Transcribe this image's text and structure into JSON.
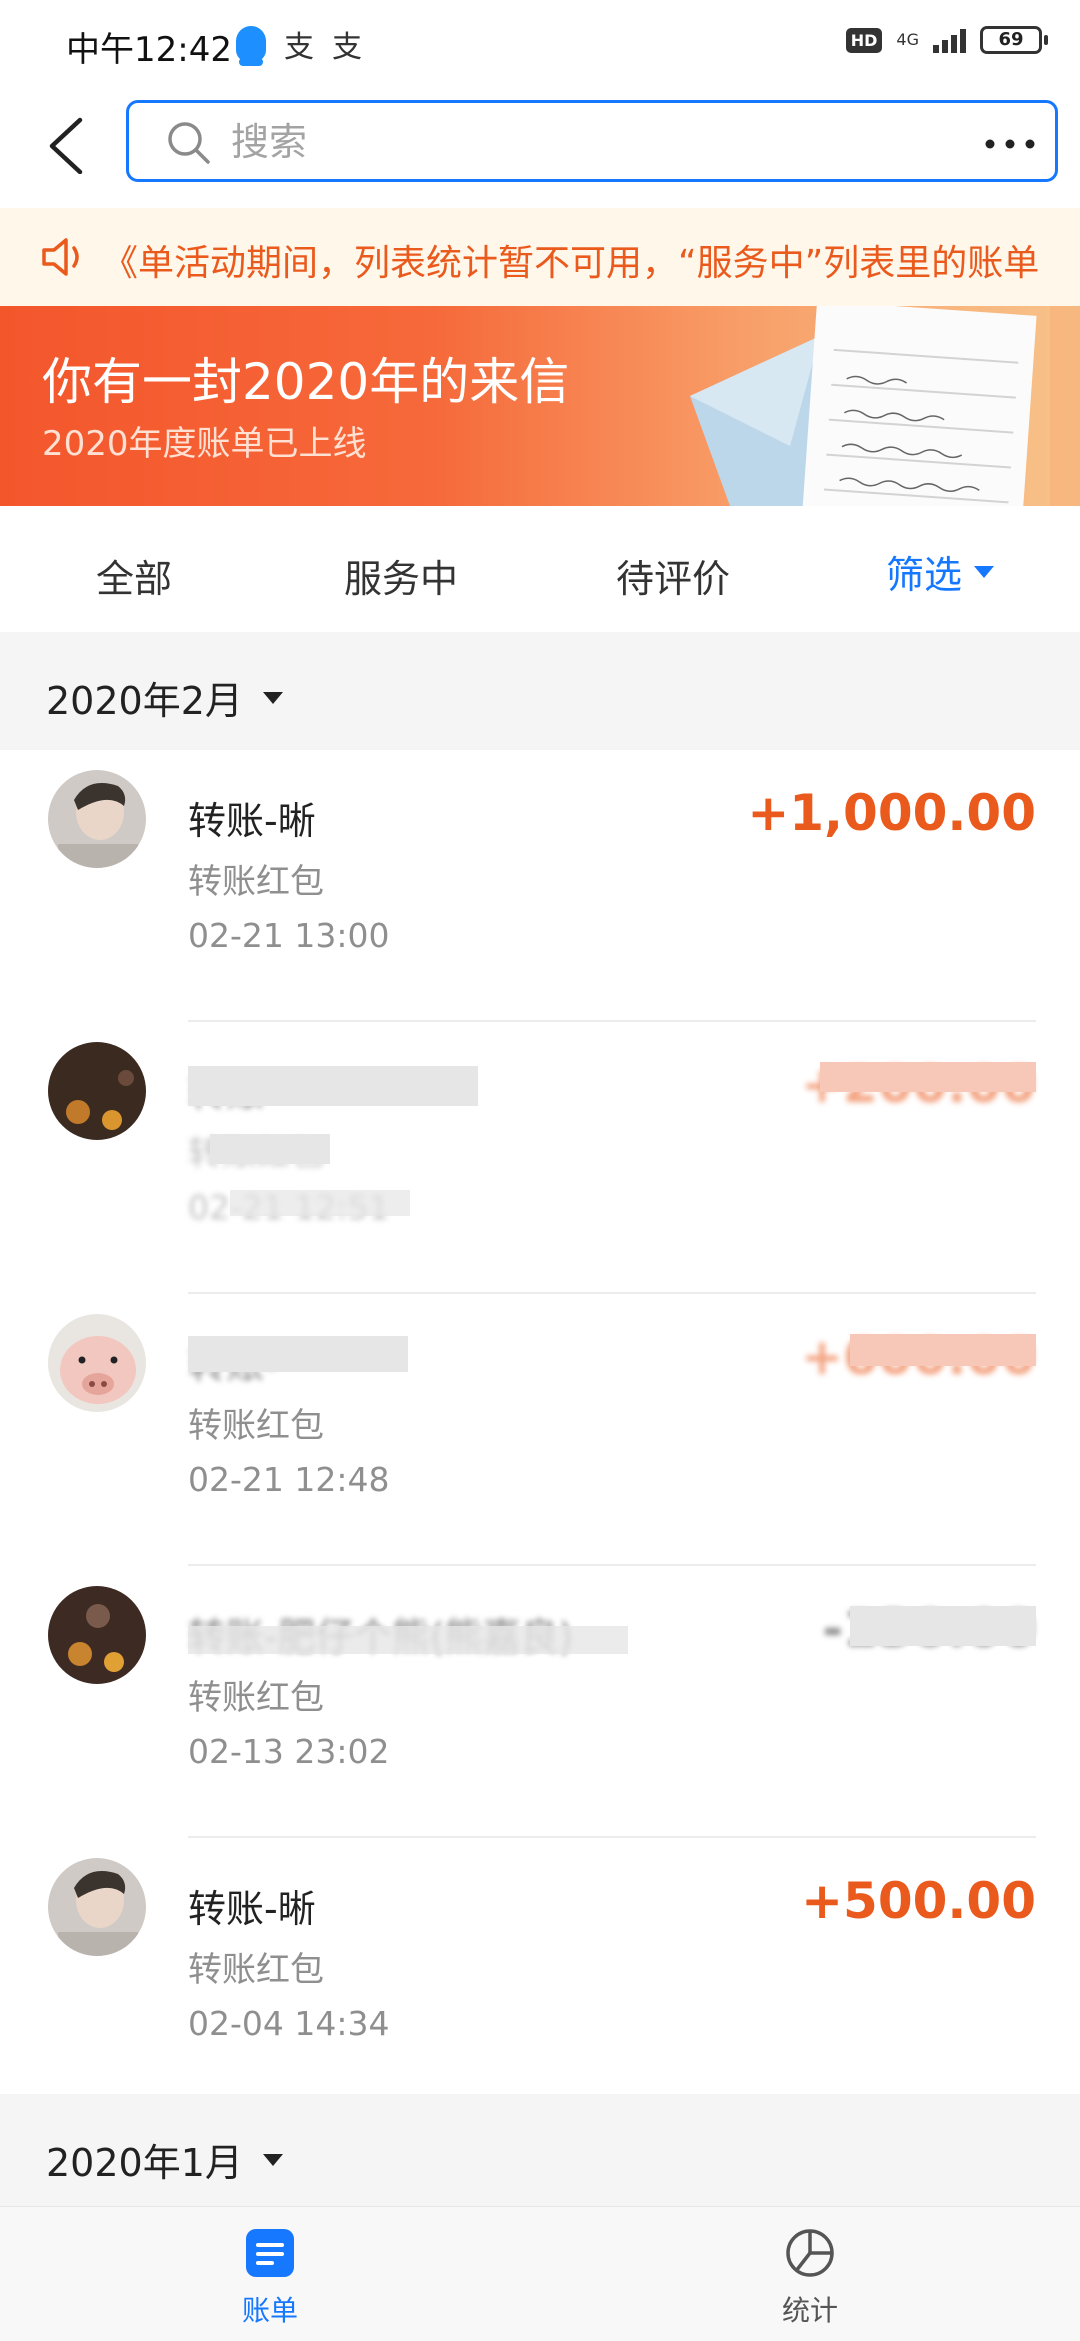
{
  "status_bar": {
    "time": "中午12:42",
    "zhi1": "支",
    "zhi2": "支",
    "hd": "HD",
    "network": "4G",
    "battery": "69"
  },
  "search": {
    "placeholder": "搜索"
  },
  "notice": {
    "text": "《单活动期间，列表统计暂不可用，“服务中”列表里的账单"
  },
  "banner": {
    "title": "你有一封2020年的来信",
    "subtitle": "2020年度账单已上线"
  },
  "tabs": {
    "all": "全部",
    "in_service": "服务中",
    "to_review": "待评价",
    "filter": "筛选"
  },
  "months": {
    "feb": "2020年2月",
    "jan": "2020年1月"
  },
  "transactions": [
    {
      "title": "转账-晰",
      "subtitle": "转账红包",
      "date": "02-21  13:00",
      "amount": "+1,000.00"
    },
    {
      "title": "转账-",
      "subtitle": "转账红包",
      "date": "02-21  12:51",
      "amount": "+200.00"
    },
    {
      "title": "转账-",
      "subtitle": "转账红包",
      "date": "02-21  12:48",
      "amount": "+600.00"
    },
    {
      "title": "转账-肥仔个熊(熊嘉良)",
      "subtitle": "转账红包",
      "date": "02-13  23:02",
      "amount": "-130.00"
    },
    {
      "title": "转账-晰",
      "subtitle": "转账红包",
      "date": "02-04  14:34",
      "amount": "+500.00"
    }
  ],
  "bottom_nav": {
    "bills": "账单",
    "stats": "统计"
  },
  "colors": {
    "accent": "#1677ff",
    "amount": "#ea5a1d",
    "notice_bg": "#fef7ea",
    "banner": "#f4562c"
  }
}
